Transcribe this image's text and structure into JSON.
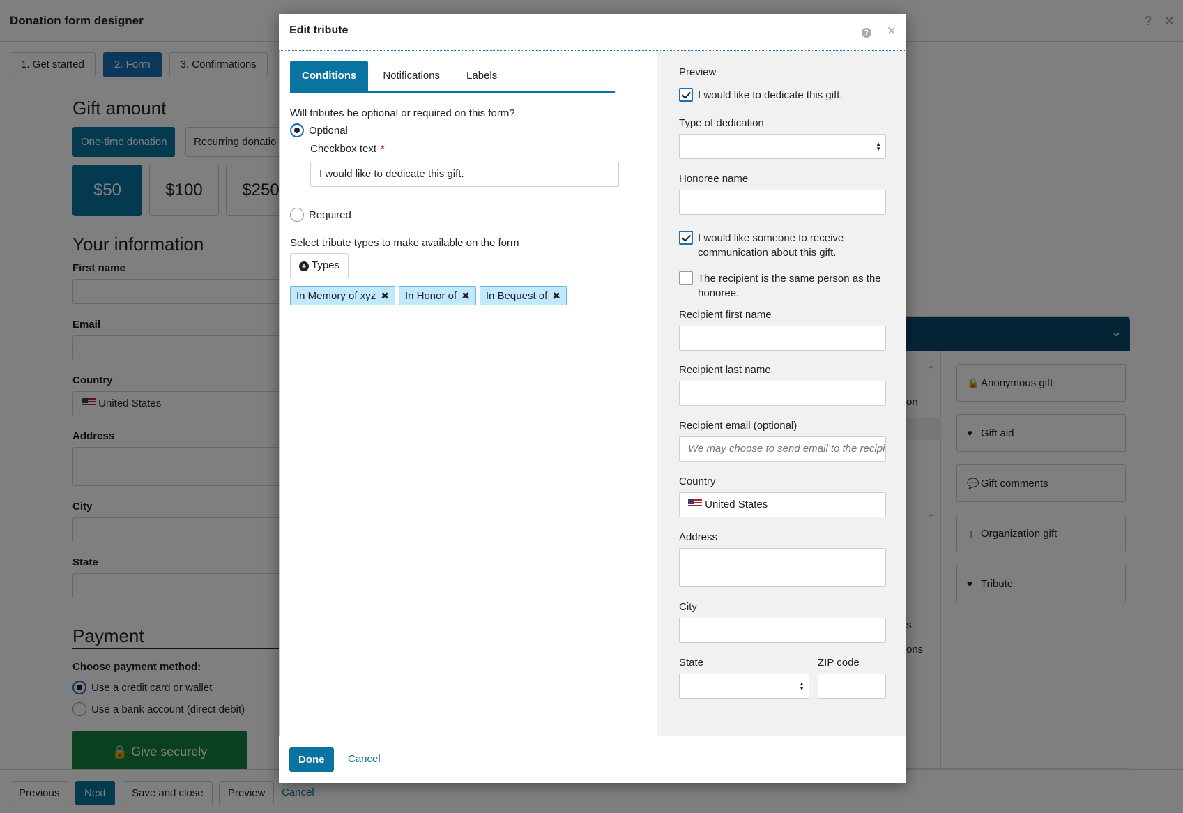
{
  "app": {
    "title": "Donation form designer",
    "steps": [
      "1. Get started",
      "2. Form",
      "3. Confirmations"
    ],
    "gift_amount_title": "Gift amount",
    "frequency": [
      "One-time donation",
      "Recurring donatio"
    ],
    "amounts": [
      "$50",
      "$100",
      "$250"
    ],
    "your_info_title": "Your information",
    "fields": {
      "first_name": "First name",
      "email": "Email",
      "country": "Country",
      "country_value": "United States",
      "address": "Address",
      "city": "City",
      "state": "State"
    },
    "payment_title": "Payment",
    "payment_method_label": "Choose payment method:",
    "payment_options": [
      "Use a credit card or wallet",
      "Use a bank account (direct debit)"
    ],
    "give_button": "Give securely",
    "footer": {
      "previous": "Previous",
      "next": "Next",
      "save_close": "Save and close",
      "preview": "Preview",
      "cancel": "Cancel"
    },
    "right_panel": {
      "fragments": [
        "on",
        "s",
        "ons"
      ],
      "items": [
        "Anonymous gift",
        "Gift aid",
        "Gift comments",
        "Organization gift",
        "Tribute"
      ]
    }
  },
  "modal": {
    "title": "Edit tribute",
    "tabs": [
      "Conditions",
      "Notifications",
      "Labels"
    ],
    "question": "Will tributes be optional or required on this form?",
    "optional_label": "Optional",
    "checkbox_text_label": "Checkbox text",
    "required_mark": "*",
    "checkbox_text_value": "I would like to dedicate this gift.",
    "required_label": "Required",
    "types_prompt": "Select tribute types to make available on the form",
    "types_button": "Types",
    "tokens": [
      "In Memory of xyz",
      "In Honor of",
      "In Bequest of"
    ],
    "done": "Done",
    "cancel": "Cancel"
  },
  "preview": {
    "title": "Preview",
    "dedicate_checkbox": "I would like to dedicate this gift.",
    "type_of_dedication": "Type of dedication",
    "honoree_name": "Honoree name",
    "receive_comm": "I would like someone to receive communication about this gift.",
    "same_person": "The recipient is the same person as the honoree.",
    "recipient_first": "Recipient first name",
    "recipient_last": "Recipient last name",
    "recipient_email": "Recipient email (optional)",
    "recipient_email_placeholder": "We may choose to send email to the recipi",
    "country": "Country",
    "country_value": "United States",
    "address": "Address",
    "city": "City",
    "state": "State",
    "zip": "ZIP code"
  }
}
